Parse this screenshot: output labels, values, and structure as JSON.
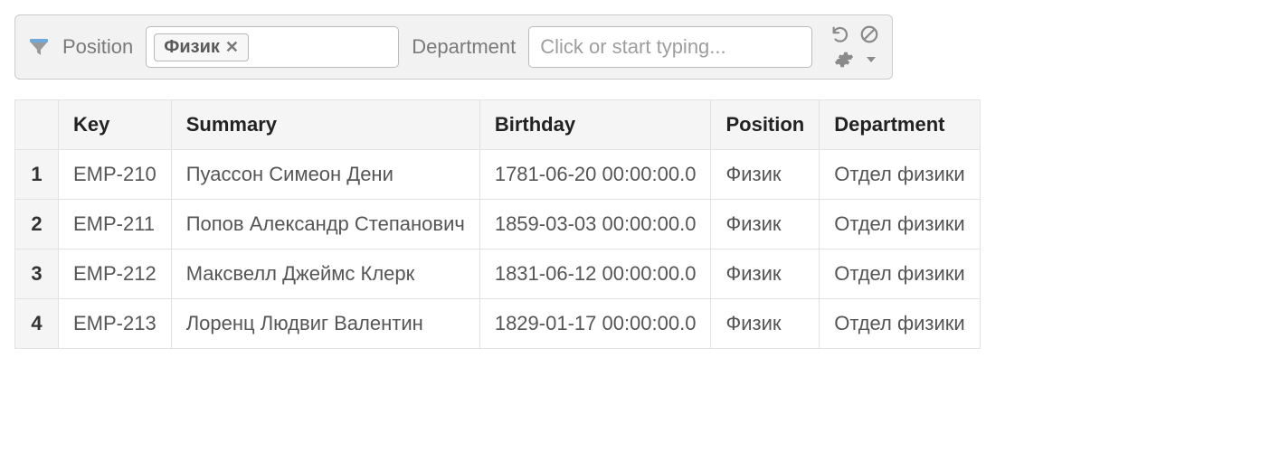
{
  "filter": {
    "position": {
      "label": "Position",
      "token": "Физик"
    },
    "department": {
      "label": "Department",
      "placeholder": "Click or start typing..."
    }
  },
  "table": {
    "headers": {
      "key": "Key",
      "summary": "Summary",
      "birthday": "Birthday",
      "position": "Position",
      "department": "Department"
    },
    "rows": [
      {
        "n": "1",
        "key": "EMP-210",
        "summary": "Пуассон Симеон Дени",
        "birthday": "1781-06-20 00:00:00.0",
        "position": "Физик",
        "department": "Отдел физики"
      },
      {
        "n": "2",
        "key": "EMP-211",
        "summary": "Попов Александр Степанович",
        "birthday": "1859-03-03 00:00:00.0",
        "position": "Физик",
        "department": "Отдел физики"
      },
      {
        "n": "3",
        "key": "EMP-212",
        "summary": "Максвелл Джеймс Клерк",
        "birthday": "1831-06-12 00:00:00.0",
        "position": "Физик",
        "department": "Отдел физики"
      },
      {
        "n": "4",
        "key": "EMP-213",
        "summary": "Лоренц Людвиг Валентин",
        "birthday": "1829-01-17 00:00:00.0",
        "position": "Физик",
        "department": "Отдел физики"
      }
    ]
  }
}
